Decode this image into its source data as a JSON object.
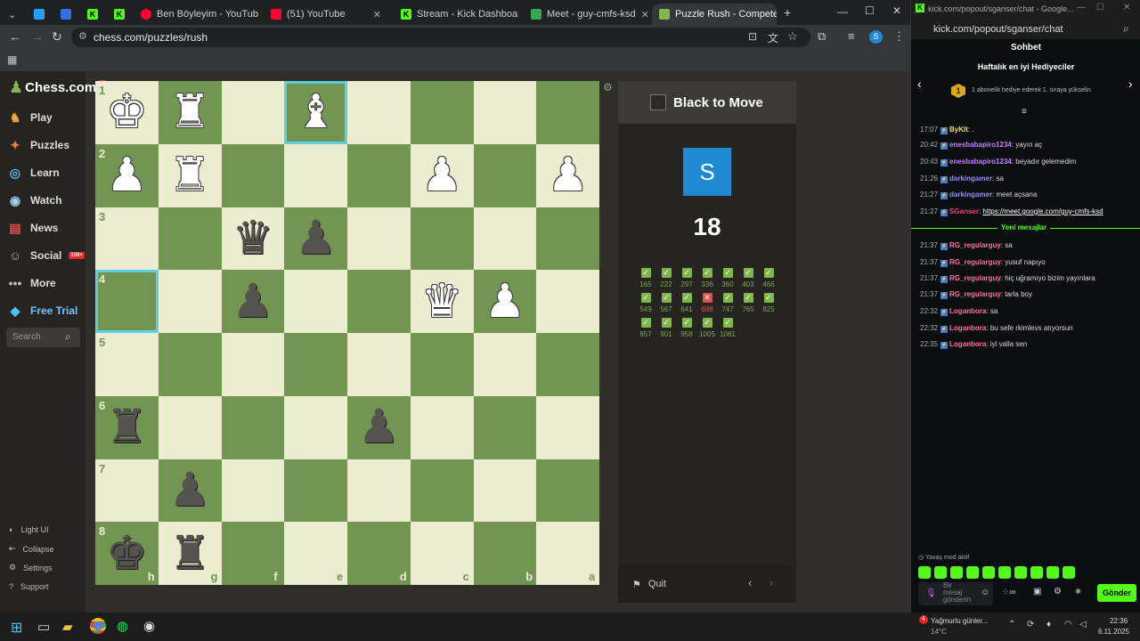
{
  "browser": {
    "tabs": [
      {
        "label": "",
        "active": false
      },
      {
        "label": "",
        "active": false
      },
      {
        "label": "",
        "active": false
      },
      {
        "label": "",
        "active": false
      },
      {
        "label": "Ben Böyleyim - YouTub",
        "active": false
      },
      {
        "label": "(51) YouTube",
        "active": false
      },
      {
        "label": "Stream - Kick Dashboard",
        "active": false
      },
      {
        "label": "Meet - guy-cmfs-ksd",
        "active": false
      },
      {
        "label": "Puzzle Rush - Compete to",
        "active": true
      }
    ],
    "url": "chess.com/puzzles/rush"
  },
  "sidebar": {
    "logo": "Chess.com",
    "logo_badge": "11",
    "items": [
      {
        "label": "Play",
        "icon": "play-icon"
      },
      {
        "label": "Puzzles",
        "icon": "puzzle-icon"
      },
      {
        "label": "Learn",
        "icon": "learn-icon"
      },
      {
        "label": "Watch",
        "icon": "watch-icon"
      },
      {
        "label": "News",
        "icon": "news-icon"
      },
      {
        "label": "Social",
        "icon": "social-icon",
        "badge": "100+"
      },
      {
        "label": "More",
        "icon": "more-icon"
      },
      {
        "label": "Free Trial",
        "icon": "diamond-icon"
      }
    ],
    "search_placeholder": "Search",
    "bottom": [
      {
        "label": "Light UI"
      },
      {
        "label": "Collapse"
      },
      {
        "label": "Settings"
      },
      {
        "label": "Support"
      }
    ]
  },
  "board": {
    "ranks": [
      "1",
      "2",
      "3",
      "4",
      "5",
      "6",
      "7",
      "8"
    ],
    "files": [
      "h",
      "g",
      "f",
      "e",
      "d",
      "c",
      "b",
      "a"
    ],
    "pieces": [
      {
        "sq": "h1",
        "glyph": "♚",
        "color": "w"
      },
      {
        "sq": "g1",
        "glyph": "♜",
        "color": "w"
      },
      {
        "sq": "e1",
        "glyph": "♝",
        "color": "w"
      },
      {
        "sq": "h2",
        "glyph": "♟",
        "color": "w"
      },
      {
        "sq": "g2",
        "glyph": "♜",
        "color": "w"
      },
      {
        "sq": "c2",
        "glyph": "♟",
        "color": "w"
      },
      {
        "sq": "a2",
        "glyph": "♟",
        "color": "w"
      },
      {
        "sq": "f3",
        "glyph": "♛",
        "color": "b"
      },
      {
        "sq": "e3",
        "glyph": "♟",
        "color": "b"
      },
      {
        "sq": "f4",
        "glyph": "♟",
        "color": "b"
      },
      {
        "sq": "c4",
        "glyph": "♛",
        "color": "w"
      },
      {
        "sq": "b4",
        "glyph": "♟",
        "color": "w"
      },
      {
        "sq": "h6",
        "glyph": "♜",
        "color": "b"
      },
      {
        "sq": "d6",
        "glyph": "♟",
        "color": "b"
      },
      {
        "sq": "g7",
        "glyph": "♟",
        "color": "b"
      },
      {
        "sq": "h8",
        "glyph": "♚",
        "color": "b"
      },
      {
        "sq": "g8",
        "glyph": "♜",
        "color": "b"
      }
    ],
    "highlighted": [
      "e1",
      "h4"
    ]
  },
  "rush": {
    "to_move": "Black to Move",
    "avatar_letter": "S",
    "score": "18",
    "results": [
      {
        "v": "165",
        "ok": true
      },
      {
        "v": "222",
        "ok": true
      },
      {
        "v": "297",
        "ok": true
      },
      {
        "v": "336",
        "ok": true
      },
      {
        "v": "360",
        "ok": true
      },
      {
        "v": "403",
        "ok": true
      },
      {
        "v": "466",
        "ok": true
      },
      {
        "v": "549",
        "ok": true
      },
      {
        "v": "567",
        "ok": true
      },
      {
        "v": "641",
        "ok": true
      },
      {
        "v": "688",
        "ok": false
      },
      {
        "v": "747",
        "ok": true
      },
      {
        "v": "765",
        "ok": true
      },
      {
        "v": "825",
        "ok": true
      },
      {
        "v": "857",
        "ok": true
      },
      {
        "v": "901",
        "ok": true
      },
      {
        "v": "958",
        "ok": true
      },
      {
        "v": "1005",
        "ok": true
      },
      {
        "v": "1081",
        "ok": true
      }
    ],
    "quit_label": "Quit"
  },
  "kick": {
    "window_title": "kick.com/popout/sganser/chat - Google...",
    "url": "kick.com/popout/sganser/chat",
    "header": "Sohbet",
    "gifters_title": "Haftalık en iyi Hediyeciler",
    "gifters_rank": "1",
    "gifters_text": "1 abonelik hediye ederek 1. sıraya yükselin",
    "new_messages": "Yeni mesajlar",
    "messages": [
      {
        "time": "17:07",
        "user": "ByKlt",
        "text": ".",
        "color": "#f0e07a"
      },
      {
        "time": "20:42",
        "user": "enesbabapiro1234",
        "text": "yayın aç",
        "color": "#c77dff"
      },
      {
        "time": "20:43",
        "user": "enesbabapiro1234",
        "text": "beyadır gelemedim",
        "color": "#c77dff"
      },
      {
        "time": "21:26",
        "user": "darkingamer",
        "text": "sa",
        "color": "#9b8cff"
      },
      {
        "time": "21:27",
        "user": "darkingamer",
        "text": "meet açsana",
        "color": "#9b8cff"
      },
      {
        "time": "21:27",
        "user": "SGanser",
        "text": "https://meet.google.com/guy-cmfs-ksd",
        "color": "#e0407a"
      },
      {
        "time": "21:37",
        "user": "RG_regularguy",
        "text": "sa",
        "color": "#ff6fa5"
      },
      {
        "time": "21:37",
        "user": "RG_regularguy",
        "text": "yusuf napıyo",
        "color": "#ff6fa5"
      },
      {
        "time": "21:37",
        "user": "RG_regularguy",
        "text": "hiç uğramıyo bizim yayınlara",
        "color": "#ff6fa5"
      },
      {
        "time": "21:37",
        "user": "RG_regularguy",
        "text": "tarla boy",
        "color": "#ff6fa5"
      },
      {
        "time": "22:32",
        "user": "Loganbora",
        "text": "sa",
        "color": "#ff6fa5"
      },
      {
        "time": "22:32",
        "user": "Loganbora",
        "text": "bu sefe rkimlevs atıyorsun",
        "color": "#ff6fa5"
      },
      {
        "time": "22:35",
        "user": "Loganbora",
        "text": "iyi valla sen",
        "color": "#ff6fa5"
      }
    ],
    "slow_mode": "Yavaş mod aktif",
    "input_placeholder": "Bir mesaj gönderin",
    "send_label": "Gönder"
  },
  "taskbar": {
    "weather": "Yağmurlu günler...",
    "temp": "14°C",
    "time": "22:36",
    "date": "6.11.2025"
  }
}
